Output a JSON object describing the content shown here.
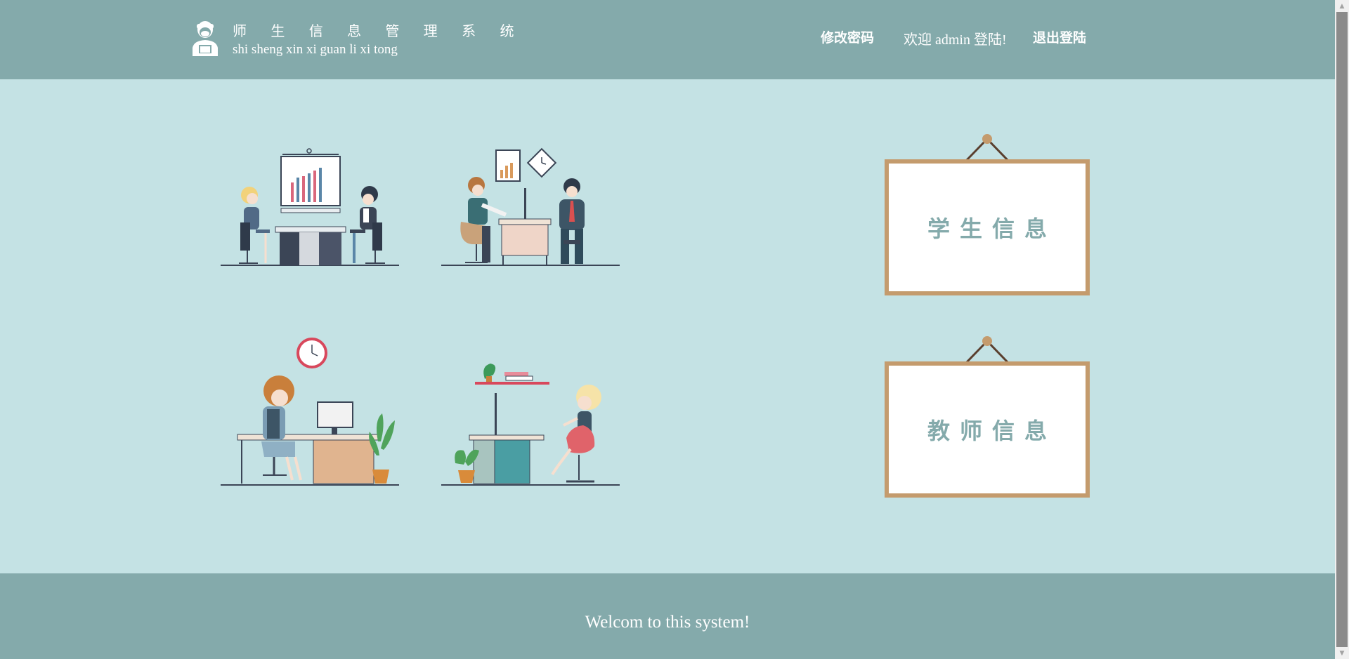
{
  "header": {
    "title": "师 生 信 息 管 理 系 统",
    "subtitle": "shi sheng xin xi guan li xi tong",
    "change_password": "修改密码",
    "welcome": "欢迎 admin 登陆!",
    "logout": "退出登陆"
  },
  "boards": {
    "student": "学生信息",
    "teacher": "教师信息"
  },
  "footer": {
    "text": "Welcom to this system!"
  },
  "colors": {
    "header_bg": "#84aaab",
    "page_bg": "#c4e2e4",
    "board_frame": "#c49b6d",
    "board_text": "#84aaab"
  }
}
